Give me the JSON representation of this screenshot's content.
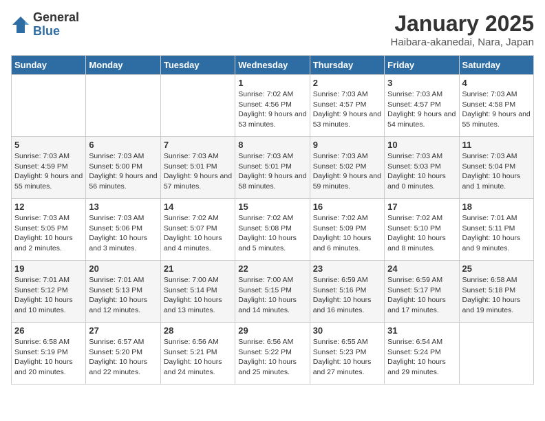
{
  "logo": {
    "general": "General",
    "blue": "Blue"
  },
  "header": {
    "month_year": "January 2025",
    "location": "Haibara-akanedai, Nara, Japan"
  },
  "weekdays": [
    "Sunday",
    "Monday",
    "Tuesday",
    "Wednesday",
    "Thursday",
    "Friday",
    "Saturday"
  ],
  "weeks": [
    [
      {
        "day": "",
        "info": ""
      },
      {
        "day": "",
        "info": ""
      },
      {
        "day": "",
        "info": ""
      },
      {
        "day": "1",
        "info": "Sunrise: 7:02 AM\nSunset: 4:56 PM\nDaylight: 9 hours and 53 minutes."
      },
      {
        "day": "2",
        "info": "Sunrise: 7:03 AM\nSunset: 4:57 PM\nDaylight: 9 hours and 53 minutes."
      },
      {
        "day": "3",
        "info": "Sunrise: 7:03 AM\nSunset: 4:57 PM\nDaylight: 9 hours and 54 minutes."
      },
      {
        "day": "4",
        "info": "Sunrise: 7:03 AM\nSunset: 4:58 PM\nDaylight: 9 hours and 55 minutes."
      }
    ],
    [
      {
        "day": "5",
        "info": "Sunrise: 7:03 AM\nSunset: 4:59 PM\nDaylight: 9 hours and 55 minutes."
      },
      {
        "day": "6",
        "info": "Sunrise: 7:03 AM\nSunset: 5:00 PM\nDaylight: 9 hours and 56 minutes."
      },
      {
        "day": "7",
        "info": "Sunrise: 7:03 AM\nSunset: 5:01 PM\nDaylight: 9 hours and 57 minutes."
      },
      {
        "day": "8",
        "info": "Sunrise: 7:03 AM\nSunset: 5:01 PM\nDaylight: 9 hours and 58 minutes."
      },
      {
        "day": "9",
        "info": "Sunrise: 7:03 AM\nSunset: 5:02 PM\nDaylight: 9 hours and 59 minutes."
      },
      {
        "day": "10",
        "info": "Sunrise: 7:03 AM\nSunset: 5:03 PM\nDaylight: 10 hours and 0 minutes."
      },
      {
        "day": "11",
        "info": "Sunrise: 7:03 AM\nSunset: 5:04 PM\nDaylight: 10 hours and 1 minute."
      }
    ],
    [
      {
        "day": "12",
        "info": "Sunrise: 7:03 AM\nSunset: 5:05 PM\nDaylight: 10 hours and 2 minutes."
      },
      {
        "day": "13",
        "info": "Sunrise: 7:03 AM\nSunset: 5:06 PM\nDaylight: 10 hours and 3 minutes."
      },
      {
        "day": "14",
        "info": "Sunrise: 7:02 AM\nSunset: 5:07 PM\nDaylight: 10 hours and 4 minutes."
      },
      {
        "day": "15",
        "info": "Sunrise: 7:02 AM\nSunset: 5:08 PM\nDaylight: 10 hours and 5 minutes."
      },
      {
        "day": "16",
        "info": "Sunrise: 7:02 AM\nSunset: 5:09 PM\nDaylight: 10 hours and 6 minutes."
      },
      {
        "day": "17",
        "info": "Sunrise: 7:02 AM\nSunset: 5:10 PM\nDaylight: 10 hours and 8 minutes."
      },
      {
        "day": "18",
        "info": "Sunrise: 7:01 AM\nSunset: 5:11 PM\nDaylight: 10 hours and 9 minutes."
      }
    ],
    [
      {
        "day": "19",
        "info": "Sunrise: 7:01 AM\nSunset: 5:12 PM\nDaylight: 10 hours and 10 minutes."
      },
      {
        "day": "20",
        "info": "Sunrise: 7:01 AM\nSunset: 5:13 PM\nDaylight: 10 hours and 12 minutes."
      },
      {
        "day": "21",
        "info": "Sunrise: 7:00 AM\nSunset: 5:14 PM\nDaylight: 10 hours and 13 minutes."
      },
      {
        "day": "22",
        "info": "Sunrise: 7:00 AM\nSunset: 5:15 PM\nDaylight: 10 hours and 14 minutes."
      },
      {
        "day": "23",
        "info": "Sunrise: 6:59 AM\nSunset: 5:16 PM\nDaylight: 10 hours and 16 minutes."
      },
      {
        "day": "24",
        "info": "Sunrise: 6:59 AM\nSunset: 5:17 PM\nDaylight: 10 hours and 17 minutes."
      },
      {
        "day": "25",
        "info": "Sunrise: 6:58 AM\nSunset: 5:18 PM\nDaylight: 10 hours and 19 minutes."
      }
    ],
    [
      {
        "day": "26",
        "info": "Sunrise: 6:58 AM\nSunset: 5:19 PM\nDaylight: 10 hours and 20 minutes."
      },
      {
        "day": "27",
        "info": "Sunrise: 6:57 AM\nSunset: 5:20 PM\nDaylight: 10 hours and 22 minutes."
      },
      {
        "day": "28",
        "info": "Sunrise: 6:56 AM\nSunset: 5:21 PM\nDaylight: 10 hours and 24 minutes."
      },
      {
        "day": "29",
        "info": "Sunrise: 6:56 AM\nSunset: 5:22 PM\nDaylight: 10 hours and 25 minutes."
      },
      {
        "day": "30",
        "info": "Sunrise: 6:55 AM\nSunset: 5:23 PM\nDaylight: 10 hours and 27 minutes."
      },
      {
        "day": "31",
        "info": "Sunrise: 6:54 AM\nSunset: 5:24 PM\nDaylight: 10 hours and 29 minutes."
      },
      {
        "day": "",
        "info": ""
      }
    ]
  ]
}
